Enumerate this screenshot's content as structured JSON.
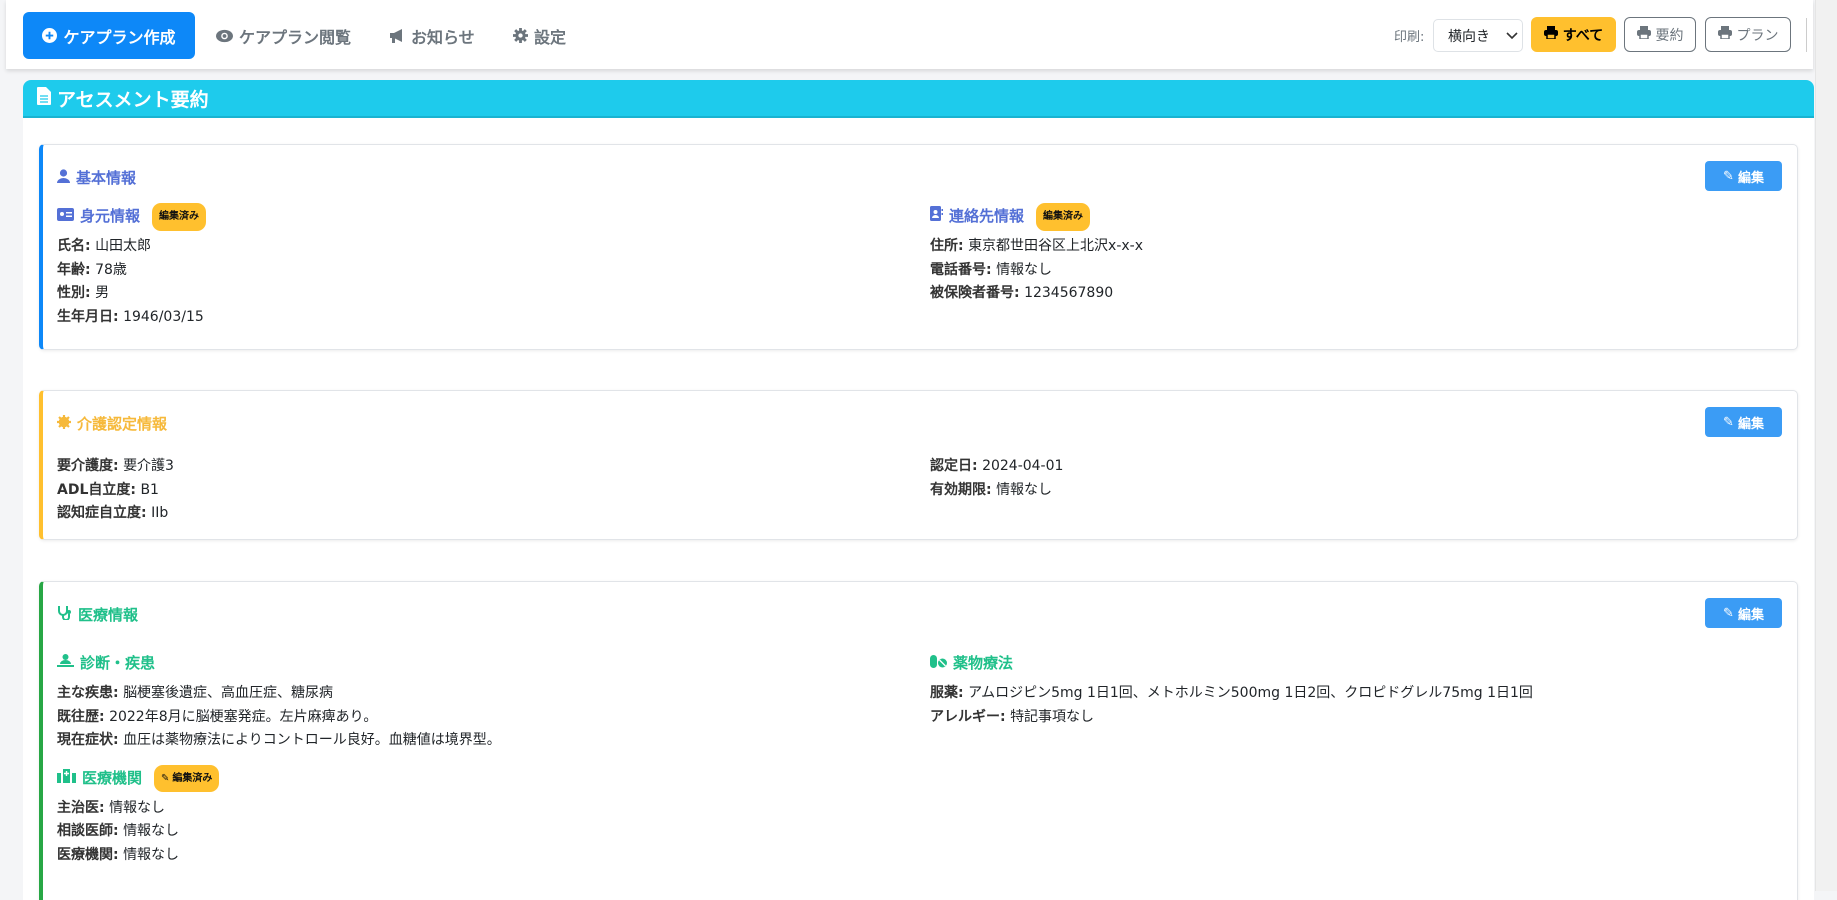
{
  "nav": {
    "tabs": [
      {
        "label": "ケアプラン作成",
        "icon": "plus-circle-icon"
      },
      {
        "label": "ケアプラン閲覧",
        "icon": "eye-icon"
      },
      {
        "label": "お知らせ",
        "icon": "megaphone-icon"
      },
      {
        "label": "設定",
        "icon": "gear-icon"
      }
    ],
    "print_label": "印刷:",
    "orientation": "横向き",
    "print_all": "すべて",
    "print_summary": "要約",
    "print_plan": "プラン"
  },
  "panel": {
    "title": "アセスメント要約"
  },
  "edit_label": "編集",
  "badge": "編集済み",
  "basic": {
    "title": "基本情報",
    "identity": {
      "title": "身元情報",
      "rows": [
        [
          "氏名:",
          "山田太郎"
        ],
        [
          "年齢:",
          "78歳"
        ],
        [
          "性別:",
          "男"
        ],
        [
          "生年月日:",
          "1946/03/15"
        ]
      ]
    },
    "contact": {
      "title": "連絡先情報",
      "rows": [
        [
          "住所:",
          "東京都世田谷区上北沢x-x-x"
        ],
        [
          "電話番号:",
          "情報なし"
        ],
        [
          "被保険者番号:",
          "1234567890"
        ]
      ]
    }
  },
  "care": {
    "title": "介護認定情報",
    "left": [
      [
        "要介護度:",
        "要介護3"
      ],
      [
        "ADL自立度:",
        "B1"
      ],
      [
        "認知症自立度:",
        "IIb"
      ]
    ],
    "right": [
      [
        "認定日:",
        "2024-04-01"
      ],
      [
        "有効期限:",
        "情報なし"
      ]
    ]
  },
  "medical": {
    "title": "医療情報",
    "diagnosis": {
      "title": "診断・疾患",
      "rows": [
        [
          "主な疾患:",
          "脳梗塞後遺症、高血圧症、糖尿病"
        ],
        [
          "既往歴:",
          "2022年8月に脳梗塞発症。左片麻痺あり。"
        ],
        [
          "現在症状:",
          "血圧は薬物療法によりコントロール良好。血糖値は境界型。"
        ]
      ]
    },
    "institution": {
      "title": "医療機関",
      "rows": [
        [
          "主治医:",
          "情報なし"
        ],
        [
          "相談医師:",
          "情報なし"
        ],
        [
          "医療機関:",
          "情報なし"
        ]
      ]
    },
    "medication": {
      "title": "薬物療法",
      "rows": [
        [
          "服薬:",
          "アムロジピン5mg 1日1回、メトホルミン500mg 1日2回、クロピドグレル75mg 1日1回"
        ],
        [
          "アレルギー:",
          "特記事項なし"
        ]
      ]
    }
  },
  "colors": {
    "primary": "#0d88f8",
    "info": "#1ecbec",
    "warning": "#ffc02e",
    "success": "#28a745"
  }
}
